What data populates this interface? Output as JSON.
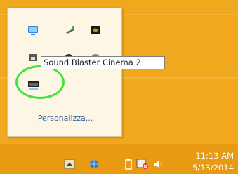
{
  "flyout": {
    "customize_label": "Personalizza...",
    "icons": [
      "display-settings-icon",
      "network-tool-icon",
      "nvidia-icon",
      "usb-device-icon",
      "circle-app-icon",
      "bluetooth-app-icon",
      "sound-blaster-cinema-icon"
    ]
  },
  "tooltip": {
    "text": "Sound Blaster Cinema 2"
  },
  "taskbar": {
    "icons": [
      "show-hidden-icons-button",
      "network-icon",
      "battery-icon",
      "action-center-icon",
      "volume-icon"
    ],
    "clock": {
      "time": "11:13 AM",
      "date": "5/13/2014"
    }
  },
  "colors": {
    "desktop": "#f1a81e",
    "taskbar": "#e89a12",
    "highlight": "#3ee63e"
  }
}
